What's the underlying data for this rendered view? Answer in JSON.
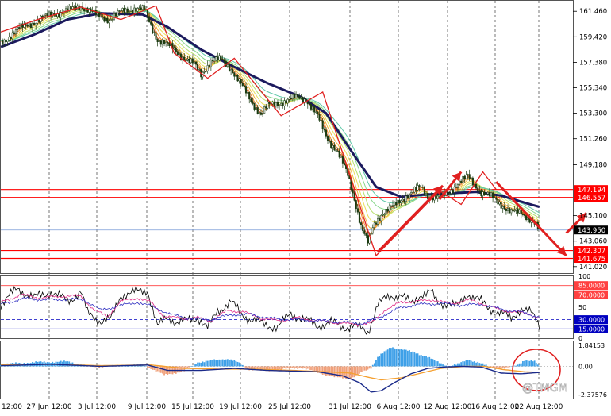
{
  "watermark": "@TMGM",
  "colors": {
    "candle": "#1a3a10",
    "ribbon_slow": "#1c1a5e",
    "ribbon": [
      "#e05a2a",
      "#f08a2a",
      "#f2b53a",
      "#e9e05a",
      "#b9e070",
      "#86d68a",
      "#5fc8a8"
    ],
    "hline_red": "#ff0000",
    "hline_blue": "#7a9cd8",
    "zigzag": "#e02020",
    "arrow": "#e02020",
    "osc_black": "#000000",
    "osc_pink": "#e0308a",
    "osc_blue": "#3030c0",
    "osc_red_lvl": "#ff4040",
    "osc_blue_lvl": "#0000c0",
    "macd_pos": "#3ea0e8",
    "macd_neg": "#f0a07a",
    "macd_line": "#1a2a8a",
    "signal_line": "#f5a030",
    "grid": "#555555"
  },
  "chart_data": [
    {
      "type": "line",
      "panel": "price",
      "y_ticks": [
        "161.460",
        "159.420",
        "157.380",
        "155.340",
        "153.300",
        "151.260",
        "149.180",
        "145.100",
        "143.060",
        "141.020"
      ],
      "ylim": [
        140.5,
        162.3
      ],
      "level_labels": [
        {
          "value": 147.194,
          "label": "147.194",
          "kind": "resistance"
        },
        {
          "value": 146.557,
          "label": "146.557",
          "kind": "resistance"
        },
        {
          "value": 143.95,
          "label": "143.950",
          "kind": "current"
        },
        {
          "value": 142.307,
          "label": "142.307",
          "kind": "support"
        },
        {
          "value": 141.675,
          "label": "141.675",
          "kind": "support"
        }
      ],
      "x_labels": [
        "12:00",
        "27 Jun 12:00",
        "3 Jul 12:00",
        "9 Jul 12:00",
        "15 Jul 12:00",
        "19 Jul 12:00",
        "25 Jul 12:00",
        "31 Jul 12:00",
        "6 Aug 12:00",
        "12 Aug 12:00",
        "16 Aug 12:00",
        "22 Aug 12:00"
      ],
      "close_anchors": [
        [
          0,
          158.9
        ],
        [
          10,
          160.0
        ],
        [
          20,
          160.6
        ],
        [
          30,
          161.2
        ],
        [
          40,
          161.5
        ],
        [
          48,
          161.9
        ],
        [
          52,
          161.6
        ],
        [
          58,
          161.1
        ],
        [
          65,
          160.8
        ],
        [
          72,
          161.4
        ],
        [
          80,
          161.7
        ],
        [
          86,
          161.6
        ],
        [
          90,
          160.3
        ],
        [
          94,
          159.2
        ],
        [
          98,
          158.9
        ],
        [
          104,
          158.4
        ],
        [
          110,
          157.7
        ],
        [
          116,
          157.2
        ],
        [
          120,
          156.4
        ],
        [
          126,
          157.5
        ],
        [
          132,
          157.6
        ],
        [
          138,
          156.9
        ],
        [
          144,
          155.6
        ],
        [
          150,
          154.3
        ],
        [
          156,
          153.2
        ],
        [
          160,
          153.9
        ],
        [
          166,
          154.1
        ],
        [
          172,
          154.3
        ],
        [
          178,
          154.6
        ],
        [
          183,
          154.4
        ],
        [
          190,
          153.0
        ],
        [
          196,
          151.3
        ],
        [
          202,
          150.1
        ],
        [
          208,
          148.4
        ],
        [
          212,
          146.5
        ],
        [
          216,
          144.2
        ],
        [
          220,
          142.9
        ],
        [
          224,
          144.5
        ],
        [
          228,
          145.2
        ],
        [
          234,
          145.7
        ],
        [
          240,
          146.4
        ],
        [
          246,
          146.9
        ],
        [
          252,
          147.4
        ],
        [
          256,
          146.7
        ],
        [
          262,
          146.5
        ],
        [
          268,
          146.9
        ],
        [
          274,
          147.7
        ],
        [
          280,
          148.2
        ],
        [
          284,
          147.6
        ],
        [
          288,
          147.0
        ],
        [
          294,
          146.6
        ],
        [
          300,
          146.0
        ],
        [
          306,
          145.4
        ],
        [
          312,
          145.3
        ],
        [
          316,
          145.0
        ],
        [
          320,
          144.5
        ],
        [
          323,
          143.9
        ]
      ],
      "ribbon_slow_anchors": [
        [
          0,
          158.6
        ],
        [
          20,
          159.6
        ],
        [
          40,
          160.8
        ],
        [
          60,
          161.3
        ],
        [
          85,
          161.2
        ],
        [
          100,
          160.2
        ],
        [
          120,
          158.4
        ],
        [
          140,
          157.0
        ],
        [
          160,
          155.7
        ],
        [
          180,
          154.6
        ],
        [
          195,
          153.3
        ],
        [
          210,
          150.3
        ],
        [
          225,
          147.4
        ],
        [
          240,
          146.6
        ],
        [
          255,
          146.8
        ],
        [
          270,
          146.9
        ],
        [
          285,
          147.0
        ],
        [
          300,
          146.7
        ],
        [
          315,
          146.1
        ],
        [
          323,
          145.8
        ]
      ],
      "zigzag_points": [
        [
          0,
          159.8
        ],
        [
          22,
          160.8
        ],
        [
          48,
          161.8
        ],
        [
          72,
          160.8
        ],
        [
          93,
          161.9
        ],
        [
          104,
          158.1
        ],
        [
          124,
          156.1
        ],
        [
          140,
          157.7
        ],
        [
          168,
          153.1
        ],
        [
          193,
          155.0
        ],
        [
          225,
          141.9
        ],
        [
          263,
          147.1
        ],
        [
          276,
          146.0
        ],
        [
          289,
          148.6
        ],
        [
          297,
          147.2
        ]
      ],
      "arrows": [
        [
          [
            226,
            142.2
          ],
          [
            265,
            147.5
          ]
        ],
        [
          [
            263,
            146.4
          ],
          [
            276,
            148.6
          ]
        ],
        [
          [
            297,
            147.8
          ],
          [
            339,
            141.9
          ]
        ],
        [
          [
            339,
            143.7
          ],
          [
            351,
            145.3
          ]
        ]
      ]
    },
    {
      "type": "line",
      "panel": "oscillator",
      "y_ticks": [
        "100",
        "85.0000",
        "70.0000",
        "50",
        "30.0000",
        "15.0000",
        "0"
      ],
      "ylim": [
        0,
        100
      ],
      "levels": [
        85,
        70,
        30,
        15
      ],
      "series": [
        {
          "color": "black",
          "anchors": [
            [
              0,
              55
            ],
            [
              10,
              80
            ],
            [
              20,
              65
            ],
            [
              30,
              75
            ],
            [
              40,
              60
            ],
            [
              48,
              75
            ],
            [
              52,
              40
            ],
            [
              60,
              28
            ],
            [
              66,
              30
            ],
            [
              72,
              70
            ],
            [
              80,
              74
            ],
            [
              88,
              78
            ],
            [
              94,
              18
            ],
            [
              100,
              35
            ],
            [
              106,
              25
            ],
            [
              112,
              28
            ],
            [
              118,
              35
            ],
            [
              124,
              15
            ],
            [
              130,
              45
            ],
            [
              138,
              58
            ],
            [
              144,
              40
            ],
            [
              150,
              30
            ],
            [
              158,
              22
            ],
            [
              166,
              18
            ],
            [
              174,
              40
            ],
            [
              182,
              30
            ],
            [
              190,
              20
            ],
            [
              198,
              25
            ],
            [
              206,
              18
            ],
            [
              212,
              20
            ],
            [
              220,
              10
            ],
            [
              226,
              55
            ],
            [
              234,
              68
            ],
            [
              240,
              70
            ],
            [
              246,
              55
            ],
            [
              252,
              72
            ],
            [
              258,
              74
            ],
            [
              262,
              56
            ],
            [
              268,
              58
            ],
            [
              274,
              50
            ],
            [
              280,
              72
            ],
            [
              286,
              64
            ],
            [
              292,
              48
            ],
            [
              300,
              42
            ],
            [
              306,
              30
            ],
            [
              312,
              50
            ],
            [
              318,
              40
            ],
            [
              323,
              20
            ]
          ]
        },
        {
          "color": "pink",
          "anchors": [
            [
              0,
              58
            ],
            [
              12,
              70
            ],
            [
              24,
              65
            ],
            [
              36,
              68
            ],
            [
              48,
              68
            ],
            [
              56,
              45
            ],
            [
              64,
              35
            ],
            [
              72,
              60
            ],
            [
              82,
              65
            ],
            [
              90,
              58
            ],
            [
              98,
              35
            ],
            [
              108,
              32
            ],
            [
              118,
              33
            ],
            [
              126,
              28
            ],
            [
              136,
              45
            ],
            [
              146,
              42
            ],
            [
              156,
              32
            ],
            [
              168,
              28
            ],
            [
              178,
              33
            ],
            [
              190,
              28
            ],
            [
              202,
              25
            ],
            [
              214,
              22
            ],
            [
              222,
              24
            ],
            [
              230,
              45
            ],
            [
              240,
              58
            ],
            [
              250,
              60
            ],
            [
              260,
              62
            ],
            [
              270,
              55
            ],
            [
              280,
              62
            ],
            [
              290,
              55
            ],
            [
              300,
              45
            ],
            [
              310,
              42
            ],
            [
              318,
              38
            ],
            [
              323,
              32
            ]
          ]
        },
        {
          "color": "blue",
          "anchors": [
            [
              0,
              55
            ],
            [
              14,
              64
            ],
            [
              28,
              62
            ],
            [
              40,
              63
            ],
            [
              50,
              62
            ],
            [
              60,
              45
            ],
            [
              70,
              52
            ],
            [
              82,
              58
            ],
            [
              92,
              50
            ],
            [
              102,
              38
            ],
            [
              114,
              32
            ],
            [
              126,
              30
            ],
            [
              138,
              38
            ],
            [
              150,
              38
            ],
            [
              162,
              32
            ],
            [
              176,
              30
            ],
            [
              190,
              28
            ],
            [
              204,
              26
            ],
            [
              218,
              24
            ],
            [
              228,
              35
            ],
            [
              240,
              50
            ],
            [
              252,
              55
            ],
            [
              264,
              56
            ],
            [
              276,
              53
            ],
            [
              288,
              55
            ],
            [
              300,
              47
            ],
            [
              312,
              42
            ],
            [
              323,
              34
            ]
          ]
        }
      ]
    },
    {
      "type": "bar",
      "panel": "macd",
      "y_ticks": [
        "1.84153",
        "0.00",
        "-2.37576"
      ],
      "ylim": [
        -2.37576,
        1.84153
      ],
      "histogram_anchors": [
        [
          0,
          0.15
        ],
        [
          20,
          0.3
        ],
        [
          40,
          0.35
        ],
        [
          55,
          -0.05
        ],
        [
          70,
          0.05
        ],
        [
          85,
          0.12
        ],
        [
          90,
          -0.15
        ],
        [
          98,
          -0.65
        ],
        [
          110,
          -0.35
        ],
        [
          118,
          0.3
        ],
        [
          128,
          0.45
        ],
        [
          136,
          0.55
        ],
        [
          142,
          0.3
        ],
        [
          148,
          -0.2
        ],
        [
          158,
          -0.35
        ],
        [
          170,
          -0.2
        ],
        [
          180,
          -0.1
        ],
        [
          190,
          -0.45
        ],
        [
          200,
          -0.8
        ],
        [
          210,
          -0.9
        ],
        [
          216,
          -0.5
        ],
        [
          222,
          -0.1
        ],
        [
          226,
          0.7
        ],
        [
          234,
          1.4
        ],
        [
          240,
          1.3
        ],
        [
          248,
          1.0
        ],
        [
          256,
          0.7
        ],
        [
          262,
          0.3
        ],
        [
          268,
          0.0
        ],
        [
          274,
          0.15
        ],
        [
          280,
          0.5
        ],
        [
          286,
          0.3
        ],
        [
          292,
          0.0
        ],
        [
          300,
          -0.2
        ],
        [
          308,
          0.0
        ],
        [
          314,
          0.45
        ],
        [
          320,
          0.35
        ],
        [
          323,
          0.0
        ]
      ],
      "macd_line_anchors": [
        [
          0,
          0.05
        ],
        [
          30,
          0.15
        ],
        [
          60,
          0.0
        ],
        [
          88,
          0.1
        ],
        [
          100,
          -0.3
        ],
        [
          120,
          -0.3
        ],
        [
          140,
          -0.15
        ],
        [
          160,
          -0.3
        ],
        [
          190,
          -0.4
        ],
        [
          205,
          -0.7
        ],
        [
          215,
          -1.2
        ],
        [
          222,
          -1.9
        ],
        [
          228,
          -1.8
        ],
        [
          236,
          -1.2
        ],
        [
          246,
          -0.55
        ],
        [
          256,
          -0.15
        ],
        [
          266,
          -0.05
        ],
        [
          276,
          0.0
        ],
        [
          288,
          -0.05
        ],
        [
          300,
          -0.5
        ],
        [
          312,
          -0.55
        ],
        [
          323,
          -0.45
        ]
      ],
      "signal_line_anchors": [
        [
          0,
          0.1
        ],
        [
          30,
          0.15
        ],
        [
          60,
          0.05
        ],
        [
          90,
          0.1
        ],
        [
          110,
          -0.15
        ],
        [
          130,
          -0.2
        ],
        [
          150,
          -0.2
        ],
        [
          175,
          -0.3
        ],
        [
          195,
          -0.4
        ],
        [
          210,
          -0.5
        ],
        [
          220,
          -0.8
        ],
        [
          228,
          -1.0
        ],
        [
          240,
          -0.85
        ],
        [
          252,
          -0.5
        ],
        [
          264,
          -0.15
        ],
        [
          278,
          0.0
        ],
        [
          290,
          0.0
        ],
        [
          302,
          -0.25
        ],
        [
          314,
          -0.4
        ],
        [
          323,
          -0.45
        ]
      ]
    }
  ]
}
